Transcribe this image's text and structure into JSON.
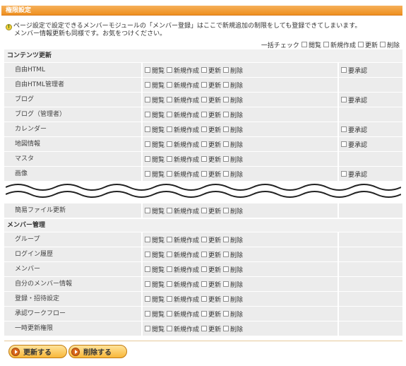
{
  "header": {
    "title": "権限設定"
  },
  "notice": {
    "line1": "ページ設定で設定できるメンバーモジュールの「メンバー登録」はここで新規追加の制限をしても登録できてしまいます。",
    "line2": "メンバー情報更新も同様です。お気をつけください。"
  },
  "bulk_check": {
    "label": "一括チェック",
    "options": [
      "閲覧",
      "新規作成",
      "更新",
      "削除"
    ]
  },
  "perm_labels": {
    "view": "閲覧",
    "create": "新規作成",
    "update": "更新",
    "delete": "削除",
    "approve": "要承認"
  },
  "content_section": {
    "title": "コンテンツ更新",
    "rows": [
      {
        "name": "自由HTML",
        "approve": true
      },
      {
        "name": "自由HTML管理者",
        "approve": false
      },
      {
        "name": "ブログ",
        "approve": true
      },
      {
        "name": "ブログ（管理者）",
        "approve": false
      },
      {
        "name": "カレンダー",
        "approve": true
      },
      {
        "name": "地図情報",
        "approve": true
      },
      {
        "name": "マスタ",
        "approve": false
      },
      {
        "name": "画像",
        "approve": true
      }
    ],
    "after_break": [
      {
        "name": "簡易ファイル更新",
        "approve": false
      }
    ]
  },
  "member_section": {
    "title": "メンバー管理",
    "rows": [
      {
        "name": "グループ"
      },
      {
        "name": "ログイン履歴"
      },
      {
        "name": "メンバー"
      },
      {
        "name": "自分のメンバー情報"
      },
      {
        "name": "登録・招待設定"
      },
      {
        "name": "承認ワークフロー"
      },
      {
        "name": "一時更新権限"
      }
    ]
  },
  "buttons": {
    "update": "更新する",
    "delete": "削除する"
  },
  "colors": {
    "header_orange": "#ee8f1f",
    "row_bg": "#ececec",
    "button_fill": "#f8b73a"
  }
}
